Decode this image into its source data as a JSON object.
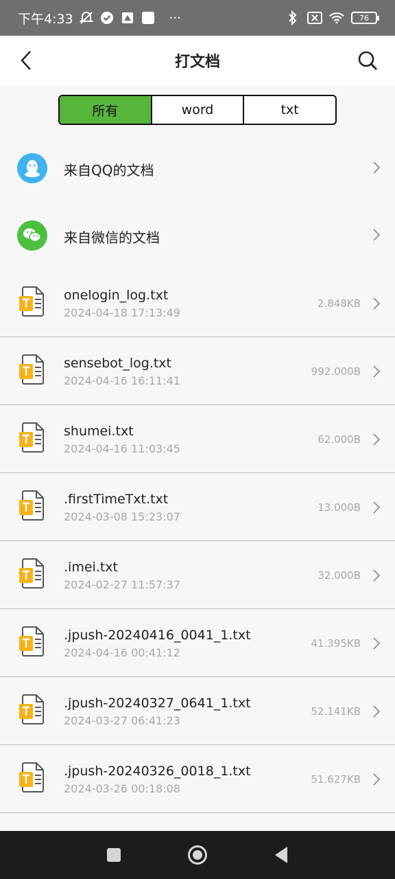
{
  "status_bar": {
    "time": "下午4:33",
    "battery": "76",
    "more": "···"
  },
  "header": {
    "title": "打文档"
  },
  "tabs": [
    {
      "label": "所有",
      "active": true
    },
    {
      "label": "word",
      "active": false
    },
    {
      "label": "txt",
      "active": false
    }
  ],
  "sources": [
    {
      "label": "来自QQ的文档",
      "icon": "qq-icon",
      "color": "#3fb2f0"
    },
    {
      "label": "来自微信的文档",
      "icon": "wechat-icon",
      "color": "#4cbf3f"
    }
  ],
  "files": [
    {
      "name": "onelogin_log.txt",
      "date": "2024-04-18 17:13:49",
      "size": "2.848KB"
    },
    {
      "name": "sensebot_log.txt",
      "date": "2024-04-16 16:11:41",
      "size": "992.000B"
    },
    {
      "name": "shumei.txt",
      "date": "2024-04-16 11:03:45",
      "size": "62.000B"
    },
    {
      "name": ".firstTimeTxt.txt",
      "date": "2024-03-08 15:23:07",
      "size": "13.000B"
    },
    {
      "name": ".imei.txt",
      "date": "2024-02-27 11:57:37",
      "size": "32.000B"
    },
    {
      "name": ".jpush-20240416_0041_1.txt",
      "date": "2024-04-16 00:41:12",
      "size": "41.395KB"
    },
    {
      "name": ".jpush-20240327_0641_1.txt",
      "date": "2024-03-27 06:41:23",
      "size": "52.141KB"
    },
    {
      "name": ".jpush-20240326_0018_1.txt",
      "date": "2024-03-26 00:18:08",
      "size": "51.627KB"
    }
  ],
  "colors": {
    "accent": "#58b53c",
    "file_icon": "#f5b31c",
    "text": "#222222",
    "muted": "#a8a8a8"
  }
}
